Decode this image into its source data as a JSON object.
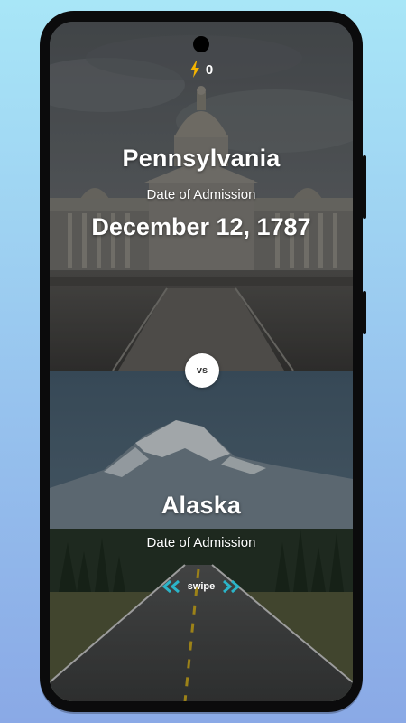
{
  "score": {
    "icon": "lightning-bolt-icon",
    "value": "0"
  },
  "top_card": {
    "name": "Pennsylvania",
    "label": "Date of Admission",
    "value": "December 12, 1787"
  },
  "vs_badge": {
    "text": "vs"
  },
  "bottom_card": {
    "name": "Alaska",
    "label": "Date of Admission"
  },
  "swipe_hint": {
    "text": "swipe",
    "left_icon": "double-chevron-left-icon",
    "right_icon": "double-chevron-right-icon"
  },
  "colors": {
    "bolt": "#f5b400",
    "chevron": "#2bb4c8",
    "vs_bg": "#ffffff"
  }
}
